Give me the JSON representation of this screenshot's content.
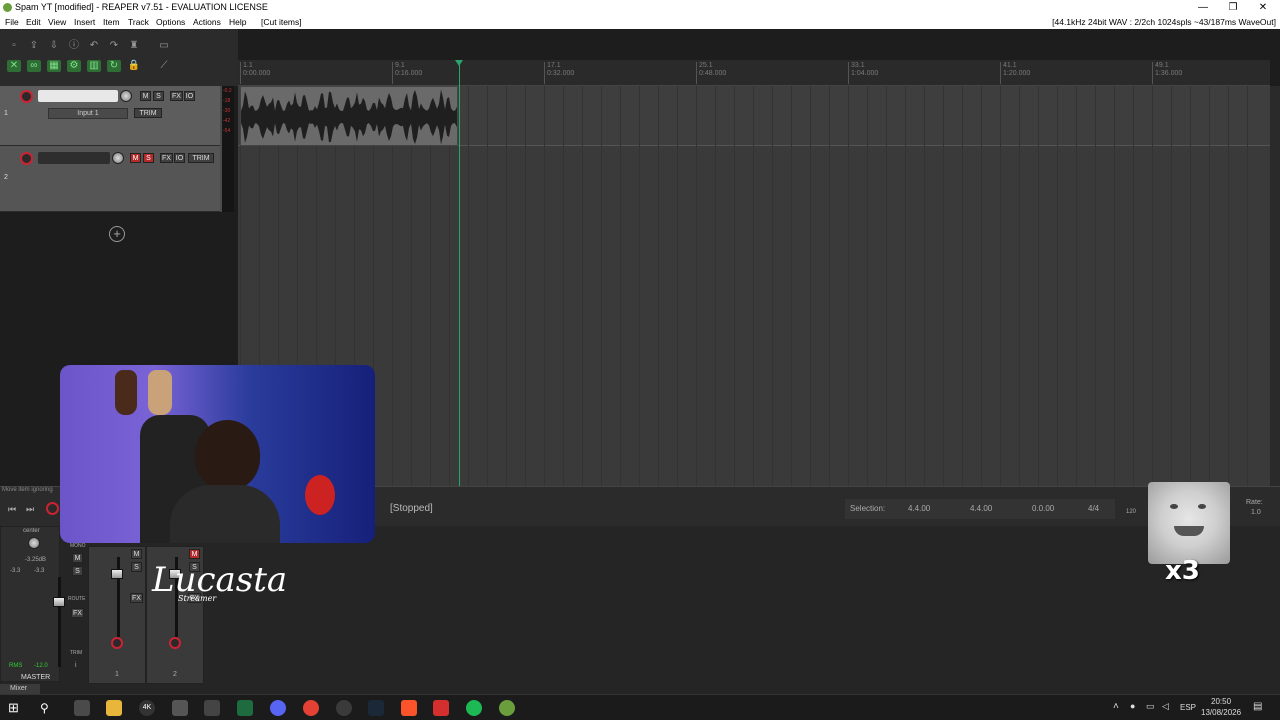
{
  "window": {
    "title": "Spam YT [modified] - REAPER v7.51 - EVALUATION LICENSE",
    "controls": [
      "—",
      "❐",
      "✕"
    ]
  },
  "menu": {
    "items": [
      "File",
      "Edit",
      "View",
      "Insert",
      "Item",
      "Track",
      "Options",
      "Actions",
      "Help",
      "[Cut items]"
    ],
    "status": "[44.1kHz 24bit WAV : 2/2ch 1024spls ~43/187ms WaveOut]"
  },
  "ruler": {
    "ticks": [
      {
        "bar": "1.1",
        "time": "0:00.000"
      },
      {
        "bar": "9.1",
        "time": "0:16.000"
      },
      {
        "bar": "17.1",
        "time": "0:32.000"
      },
      {
        "bar": "25.1",
        "time": "0:48.000"
      },
      {
        "bar": "33.1",
        "time": "1:04.000"
      },
      {
        "bar": "41.1",
        "time": "1:20.000"
      },
      {
        "bar": "49.1",
        "time": "1:36.000"
      }
    ]
  },
  "tracks": [
    {
      "number": "1",
      "input": "Input 1",
      "trim": "TRIM"
    },
    {
      "number": "2",
      "trim": "TRIM"
    }
  ],
  "track_meter_labels": [
    "-0.2",
    "-18",
    "-30",
    "-42",
    "-54"
  ],
  "buttons": {
    "mute": "M",
    "solo": "S",
    "fx": "FX",
    "io": "IO",
    "add_track": "+"
  },
  "transport": {
    "state": "[Stopped]",
    "hint": "Move item ignoring",
    "selection_label": "Selection:",
    "selection_start": "4.4.00",
    "selection_end": "4.4.00",
    "selection_length": "0.0.00",
    "time_signature": "4/4",
    "tempo": "120",
    "rate_label": "Rate:",
    "rate_value": "1.0"
  },
  "mixer": {
    "master_label": "MASTER",
    "pan_label": "center",
    "volume_db": "-3.25dB",
    "peak_left": "-3.3",
    "peak_right": "-3.3",
    "rms_label": "RMS",
    "rms_value": "-12.0",
    "mono_label": "MONO",
    "route_label": "ROUTE",
    "trim_label": "TRIM",
    "info_label": "i",
    "tab_label": "Mixer",
    "channels": [
      "1",
      "2"
    ]
  },
  "overlay": {
    "logo_text": "Lucasta",
    "logo_sub": "Streamer",
    "badge": "x3"
  },
  "taskbar": {
    "language": "ESP",
    "time": "20:50",
    "date": "13/08/2026"
  },
  "colors": {
    "accent_green": "#2aa56b",
    "record_red": "#c22233",
    "waveform": "#1f1f1f"
  }
}
